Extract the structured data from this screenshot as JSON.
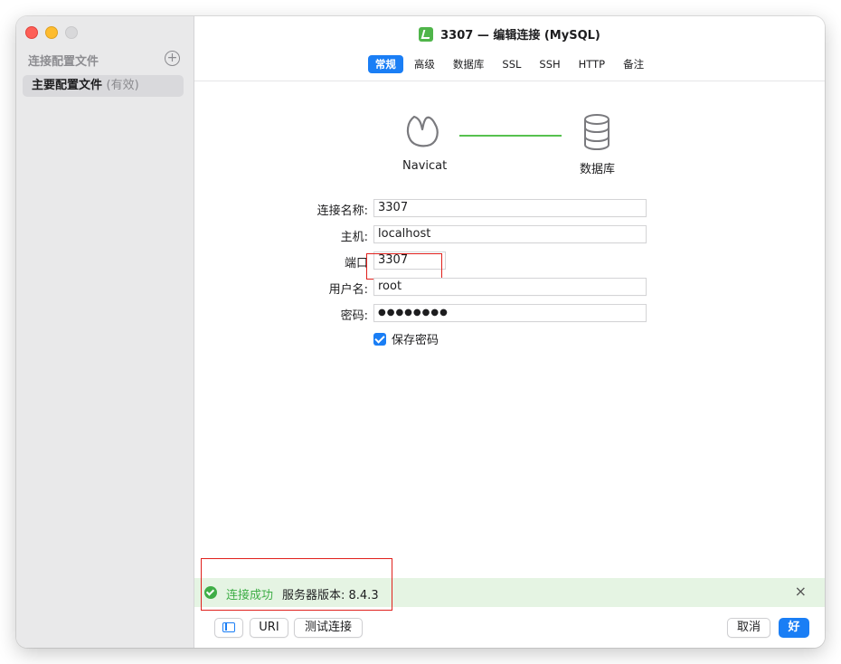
{
  "window": {
    "title": "3307 — 编辑连接 (MySQL)"
  },
  "sidebar": {
    "header": "连接配置文件",
    "items": [
      {
        "label": "主要配置文件",
        "status": "(有效)"
      }
    ]
  },
  "tabs": [
    {
      "label": "常规",
      "active": true
    },
    {
      "label": "高级",
      "active": false
    },
    {
      "label": "数据库",
      "active": false
    },
    {
      "label": "SSL",
      "active": false
    },
    {
      "label": "SSH",
      "active": false
    },
    {
      "label": "HTTP",
      "active": false
    },
    {
      "label": "备注",
      "active": false
    }
  ],
  "diagram": {
    "left_label": "Navicat",
    "right_label": "数据库"
  },
  "form": {
    "connection_name_label": "连接名称:",
    "connection_name_value": "3307",
    "host_label": "主机:",
    "host_value": "localhost",
    "port_label": "端口",
    "port_value": "3307",
    "username_label": "用户名:",
    "username_value": "root",
    "password_label": "密码:",
    "password_value": "●●●●●●●●",
    "save_password_label": "保存密码",
    "save_password_checked": true
  },
  "status": {
    "success_text": "连接成功",
    "version_text": "服务器版本: 8.4.3"
  },
  "footer": {
    "uri_label": "URI",
    "test_label": "测试连接",
    "cancel_label": "取消",
    "ok_label": "好"
  },
  "icons": {
    "close": "×",
    "add": "+"
  },
  "colors": {
    "accent": "#1a7ef5",
    "success": "#3fae47",
    "annotation": "#e0201c"
  }
}
